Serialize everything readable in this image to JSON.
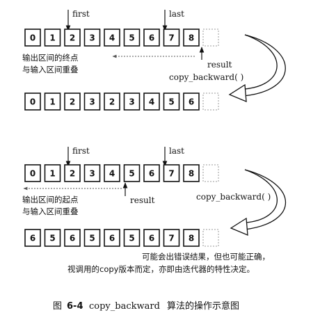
{
  "top": {
    "first_label": "first",
    "last_label": "last",
    "input_cells": [
      "0",
      "1",
      "2",
      "3",
      "4",
      "5",
      "6",
      "7",
      "8"
    ],
    "note_line1": "输出区间的终点",
    "note_line2": "与输入区间重叠",
    "result_label": "result",
    "call_label": "copy_backward( )",
    "output_cells": [
      "0",
      "1",
      "2",
      "3",
      "2",
      "3",
      "4",
      "5",
      "6"
    ]
  },
  "bottom": {
    "first_label": "first",
    "last_label": "last",
    "input_cells": [
      "0",
      "1",
      "2",
      "3",
      "4",
      "5",
      "6",
      "7",
      "8"
    ],
    "note_line1": "输出区间的起点",
    "note_line2": "与输入区间重叠",
    "result_label": "result",
    "call_label": "copy_backward( )",
    "output_cells": [
      "6",
      "5",
      "6",
      "5",
      "6",
      "5",
      "6",
      "7",
      "8"
    ],
    "remark_line1": "可能会出错误结果，但也可能正确，",
    "remark_line2": "视调用的copy版本而定，亦即由迭代器的特性决定。"
  },
  "caption": {
    "prefix": "图",
    "number": "6-4",
    "code": "copy_backward",
    "suffix": "算法的操作示意图"
  }
}
